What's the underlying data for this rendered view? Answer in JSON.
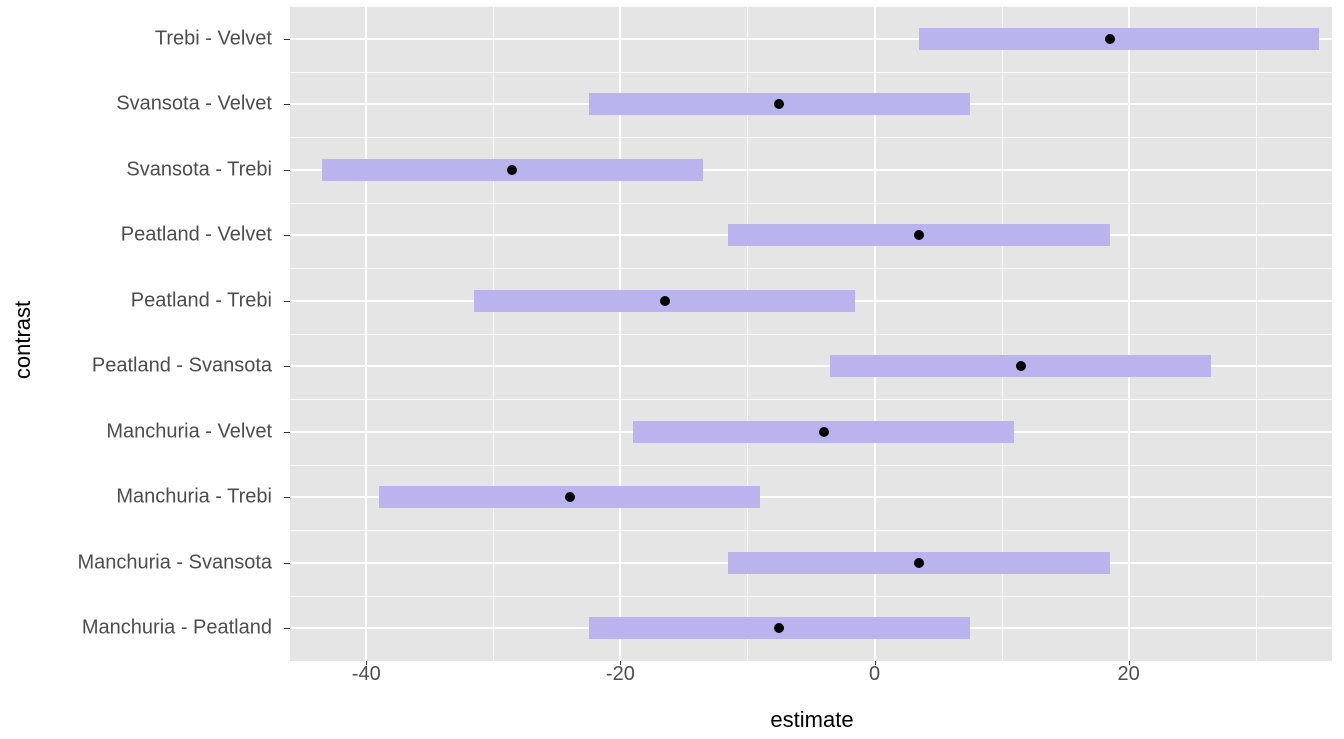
{
  "chart_data": {
    "type": "interval",
    "xlabel": "estimate",
    "ylabel": "contrast",
    "xlim": [
      -46,
      36
    ],
    "xticks": [
      -40,
      -20,
      0,
      20
    ],
    "xticks_minor": [
      -30,
      -10,
      10,
      30
    ],
    "bar_color": "#b9b4ed",
    "categories_top_to_bottom": [
      "Trebi - Velvet",
      "Svansota - Velvet",
      "Svansota - Trebi",
      "Peatland - Velvet",
      "Peatland - Trebi",
      "Peatland - Svansota",
      "Manchuria - Velvet",
      "Manchuria - Trebi",
      "Manchuria - Svansota",
      "Manchuria - Peatland"
    ],
    "series": [
      {
        "contrast": "Trebi - Velvet",
        "estimate": 18.5,
        "lower": 3.5,
        "upper": 35.0
      },
      {
        "contrast": "Svansota - Velvet",
        "estimate": -7.5,
        "lower": -22.5,
        "upper": 7.5
      },
      {
        "contrast": "Svansota - Trebi",
        "estimate": -28.5,
        "lower": -43.5,
        "upper": -13.5
      },
      {
        "contrast": "Peatland - Velvet",
        "estimate": 3.5,
        "lower": -11.5,
        "upper": 18.5
      },
      {
        "contrast": "Peatland - Trebi",
        "estimate": -16.5,
        "lower": -31.5,
        "upper": -1.5
      },
      {
        "contrast": "Peatland - Svansota",
        "estimate": 11.5,
        "lower": -3.5,
        "upper": 26.5
      },
      {
        "contrast": "Manchuria - Velvet",
        "estimate": -4.0,
        "lower": -19.0,
        "upper": 11.0
      },
      {
        "contrast": "Manchuria - Trebi",
        "estimate": -24.0,
        "lower": -39.0,
        "upper": -9.0
      },
      {
        "contrast": "Manchuria - Svansota",
        "estimate": 3.5,
        "lower": -11.5,
        "upper": 18.5
      },
      {
        "contrast": "Manchuria - Peatland",
        "estimate": -7.5,
        "lower": -22.5,
        "upper": 7.5
      }
    ]
  }
}
